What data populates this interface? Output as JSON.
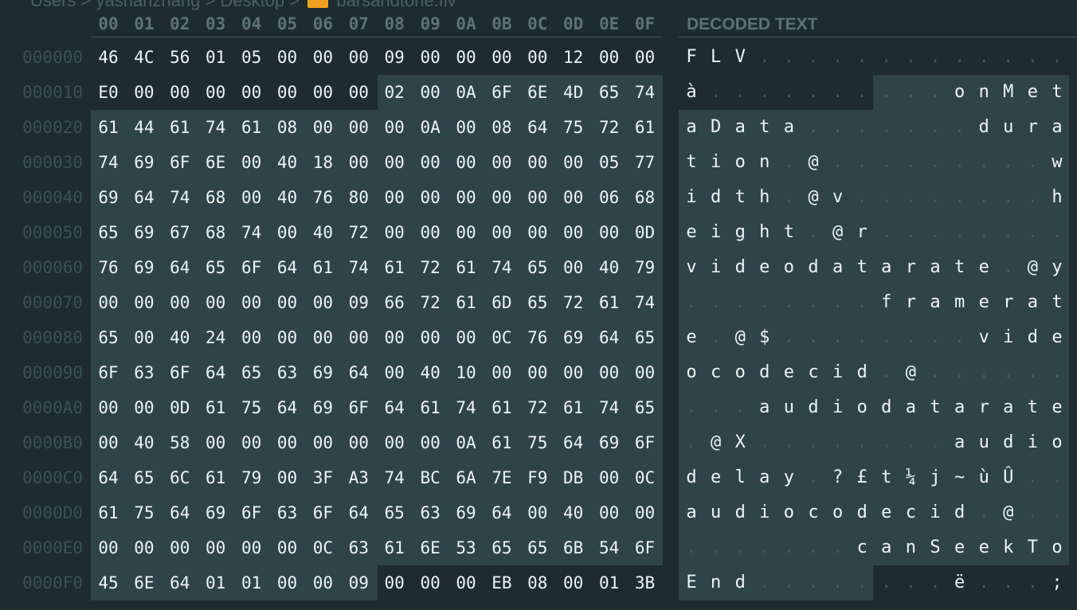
{
  "breadcrumb": {
    "path": "Users  >  yasharizhang  >  Desktop  >",
    "file": "barsandtone.flv"
  },
  "header": {
    "columns": [
      "00",
      "01",
      "02",
      "03",
      "04",
      "05",
      "06",
      "07",
      "08",
      "09",
      "0A",
      "0B",
      "0C",
      "0D",
      "0E",
      "0F"
    ],
    "decoded_title": "DECODED TEXT"
  },
  "rows": [
    {
      "offset": "000000",
      "bytes": [
        "46",
        "4C",
        "56",
        "01",
        "05",
        "00",
        "00",
        "00",
        "09",
        "00",
        "00",
        "00",
        "00",
        "12",
        "00",
        "00"
      ],
      "chars": [
        "F",
        "L",
        "V",
        ".",
        ".",
        ".",
        ".",
        ".",
        ".",
        ".",
        ".",
        ".",
        ".",
        ".",
        ".",
        "."
      ]
    },
    {
      "offset": "000010",
      "bytes": [
        "E0",
        "00",
        "00",
        "00",
        "00",
        "00",
        "00",
        "00",
        "02",
        "00",
        "0A",
        "6F",
        "6E",
        "4D",
        "65",
        "74"
      ],
      "chars": [
        "à",
        ".",
        ".",
        ".",
        ".",
        ".",
        ".",
        ".",
        ".",
        ".",
        ".",
        "o",
        "n",
        "M",
        "e",
        "t"
      ]
    },
    {
      "offset": "000020",
      "bytes": [
        "61",
        "44",
        "61",
        "74",
        "61",
        "08",
        "00",
        "00",
        "00",
        "0A",
        "00",
        "08",
        "64",
        "75",
        "72",
        "61"
      ],
      "chars": [
        "a",
        "D",
        "a",
        "t",
        "a",
        ".",
        ".",
        ".",
        ".",
        ".",
        ".",
        ".",
        "d",
        "u",
        "r",
        "a"
      ]
    },
    {
      "offset": "000030",
      "bytes": [
        "74",
        "69",
        "6F",
        "6E",
        "00",
        "40",
        "18",
        "00",
        "00",
        "00",
        "00",
        "00",
        "00",
        "00",
        "05",
        "77"
      ],
      "chars": [
        "t",
        "i",
        "o",
        "n",
        ".",
        "@",
        ".",
        ".",
        ".",
        ".",
        ".",
        ".",
        ".",
        ".",
        ".",
        "w"
      ]
    },
    {
      "offset": "000040",
      "bytes": [
        "69",
        "64",
        "74",
        "68",
        "00",
        "40",
        "76",
        "80",
        "00",
        "00",
        "00",
        "00",
        "00",
        "00",
        "06",
        "68"
      ],
      "chars": [
        "i",
        "d",
        "t",
        "h",
        ".",
        "@",
        "v",
        ".",
        ".",
        ".",
        ".",
        ".",
        ".",
        ".",
        ".",
        "h"
      ]
    },
    {
      "offset": "000050",
      "bytes": [
        "65",
        "69",
        "67",
        "68",
        "74",
        "00",
        "40",
        "72",
        "00",
        "00",
        "00",
        "00",
        "00",
        "00",
        "00",
        "0D"
      ],
      "chars": [
        "e",
        "i",
        "g",
        "h",
        "t",
        ".",
        "@",
        "r",
        ".",
        ".",
        ".",
        ".",
        ".",
        ".",
        ".",
        "."
      ]
    },
    {
      "offset": "000060",
      "bytes": [
        "76",
        "69",
        "64",
        "65",
        "6F",
        "64",
        "61",
        "74",
        "61",
        "72",
        "61",
        "74",
        "65",
        "00",
        "40",
        "79"
      ],
      "chars": [
        "v",
        "i",
        "d",
        "e",
        "o",
        "d",
        "a",
        "t",
        "a",
        "r",
        "a",
        "t",
        "e",
        ".",
        "@",
        "y"
      ]
    },
    {
      "offset": "000070",
      "bytes": [
        "00",
        "00",
        "00",
        "00",
        "00",
        "00",
        "00",
        "09",
        "66",
        "72",
        "61",
        "6D",
        "65",
        "72",
        "61",
        "74"
      ],
      "chars": [
        ".",
        ".",
        ".",
        ".",
        ".",
        ".",
        ".",
        ".",
        "f",
        "r",
        "a",
        "m",
        "e",
        "r",
        "a",
        "t"
      ]
    },
    {
      "offset": "000080",
      "bytes": [
        "65",
        "00",
        "40",
        "24",
        "00",
        "00",
        "00",
        "00",
        "00",
        "00",
        "00",
        "0C",
        "76",
        "69",
        "64",
        "65"
      ],
      "chars": [
        "e",
        ".",
        "@",
        "$",
        ".",
        ".",
        ".",
        ".",
        ".",
        ".",
        ".",
        ".",
        "v",
        "i",
        "d",
        "e"
      ]
    },
    {
      "offset": "000090",
      "bytes": [
        "6F",
        "63",
        "6F",
        "64",
        "65",
        "63",
        "69",
        "64",
        "00",
        "40",
        "10",
        "00",
        "00",
        "00",
        "00",
        "00"
      ],
      "chars": [
        "o",
        "c",
        "o",
        "d",
        "e",
        "c",
        "i",
        "d",
        ".",
        "@",
        ".",
        ".",
        ".",
        ".",
        ".",
        "."
      ]
    },
    {
      "offset": "0000A0",
      "bytes": [
        "00",
        "00",
        "0D",
        "61",
        "75",
        "64",
        "69",
        "6F",
        "64",
        "61",
        "74",
        "61",
        "72",
        "61",
        "74",
        "65"
      ],
      "chars": [
        ".",
        ".",
        ".",
        "a",
        "u",
        "d",
        "i",
        "o",
        "d",
        "a",
        "t",
        "a",
        "r",
        "a",
        "t",
        "e"
      ]
    },
    {
      "offset": "0000B0",
      "bytes": [
        "00",
        "40",
        "58",
        "00",
        "00",
        "00",
        "00",
        "00",
        "00",
        "00",
        "0A",
        "61",
        "75",
        "64",
        "69",
        "6F"
      ],
      "chars": [
        ".",
        "@",
        "X",
        ".",
        ".",
        ".",
        ".",
        ".",
        ".",
        ".",
        ".",
        "a",
        "u",
        "d",
        "i",
        "o"
      ]
    },
    {
      "offset": "0000C0",
      "bytes": [
        "64",
        "65",
        "6C",
        "61",
        "79",
        "00",
        "3F",
        "A3",
        "74",
        "BC",
        "6A",
        "7E",
        "F9",
        "DB",
        "00",
        "0C"
      ],
      "chars": [
        "d",
        "e",
        "l",
        "a",
        "y",
        ".",
        "?",
        "£",
        "t",
        "¼",
        "j",
        "~",
        "ù",
        "Û",
        ".",
        "."
      ]
    },
    {
      "offset": "0000D0",
      "bytes": [
        "61",
        "75",
        "64",
        "69",
        "6F",
        "63",
        "6F",
        "64",
        "65",
        "63",
        "69",
        "64",
        "00",
        "40",
        "00",
        "00"
      ],
      "chars": [
        "a",
        "u",
        "d",
        "i",
        "o",
        "c",
        "o",
        "d",
        "e",
        "c",
        "i",
        "d",
        ".",
        "@",
        ".",
        "."
      ]
    },
    {
      "offset": "0000E0",
      "bytes": [
        "00",
        "00",
        "00",
        "00",
        "00",
        "00",
        "0C",
        "63",
        "61",
        "6E",
        "53",
        "65",
        "65",
        "6B",
        "54",
        "6F"
      ],
      "chars": [
        ".",
        ".",
        ".",
        ".",
        ".",
        ".",
        ".",
        "c",
        "a",
        "n",
        "S",
        "e",
        "e",
        "k",
        "T",
        "o"
      ]
    },
    {
      "offset": "0000F0",
      "bytes": [
        "45",
        "6E",
        "64",
        "01",
        "01",
        "00",
        "00",
        "09",
        "00",
        "00",
        "00",
        "EB",
        "08",
        "00",
        "01",
        "3B"
      ],
      "chars": [
        "E",
        "n",
        "d",
        ".",
        ".",
        ".",
        ".",
        ".",
        ".",
        ".",
        ".",
        "ë",
        ".",
        ".",
        ".",
        ";"
      ]
    }
  ],
  "colors": {
    "background": "#1e2b2f",
    "highlight": "#2f4448",
    "dim_text": "#46595d",
    "header_text": "#5c7378",
    "folder_icon": "#f0a020"
  }
}
